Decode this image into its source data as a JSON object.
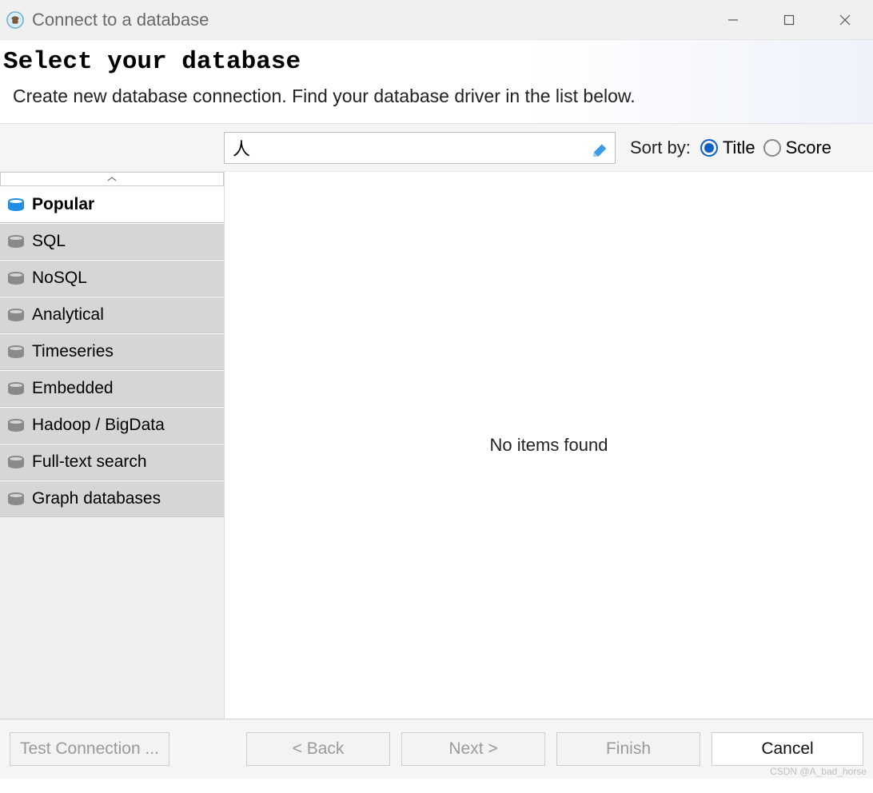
{
  "window": {
    "title": "Connect to a database"
  },
  "header": {
    "heading": "Select your database",
    "description": "Create new database connection. Find your database driver in the list below."
  },
  "search": {
    "value": "人"
  },
  "sort": {
    "label": "Sort by:",
    "options": [
      {
        "label": "Title",
        "selected": true
      },
      {
        "label": "Score",
        "selected": false
      }
    ]
  },
  "categories": [
    {
      "label": "Popular",
      "selected": true
    },
    {
      "label": "SQL",
      "selected": false
    },
    {
      "label": "NoSQL",
      "selected": false
    },
    {
      "label": "Analytical",
      "selected": false
    },
    {
      "label": "Timeseries",
      "selected": false
    },
    {
      "label": "Embedded",
      "selected": false
    },
    {
      "label": "Hadoop / BigData",
      "selected": false
    },
    {
      "label": "Full-text search",
      "selected": false
    },
    {
      "label": "Graph databases",
      "selected": false
    }
  ],
  "results": {
    "empty_text": "No items found"
  },
  "footer": {
    "test": "Test Connection ...",
    "back": "< Back",
    "next": "Next >",
    "finish": "Finish",
    "cancel": "Cancel"
  },
  "watermark": "CSDN @A_bad_horse"
}
